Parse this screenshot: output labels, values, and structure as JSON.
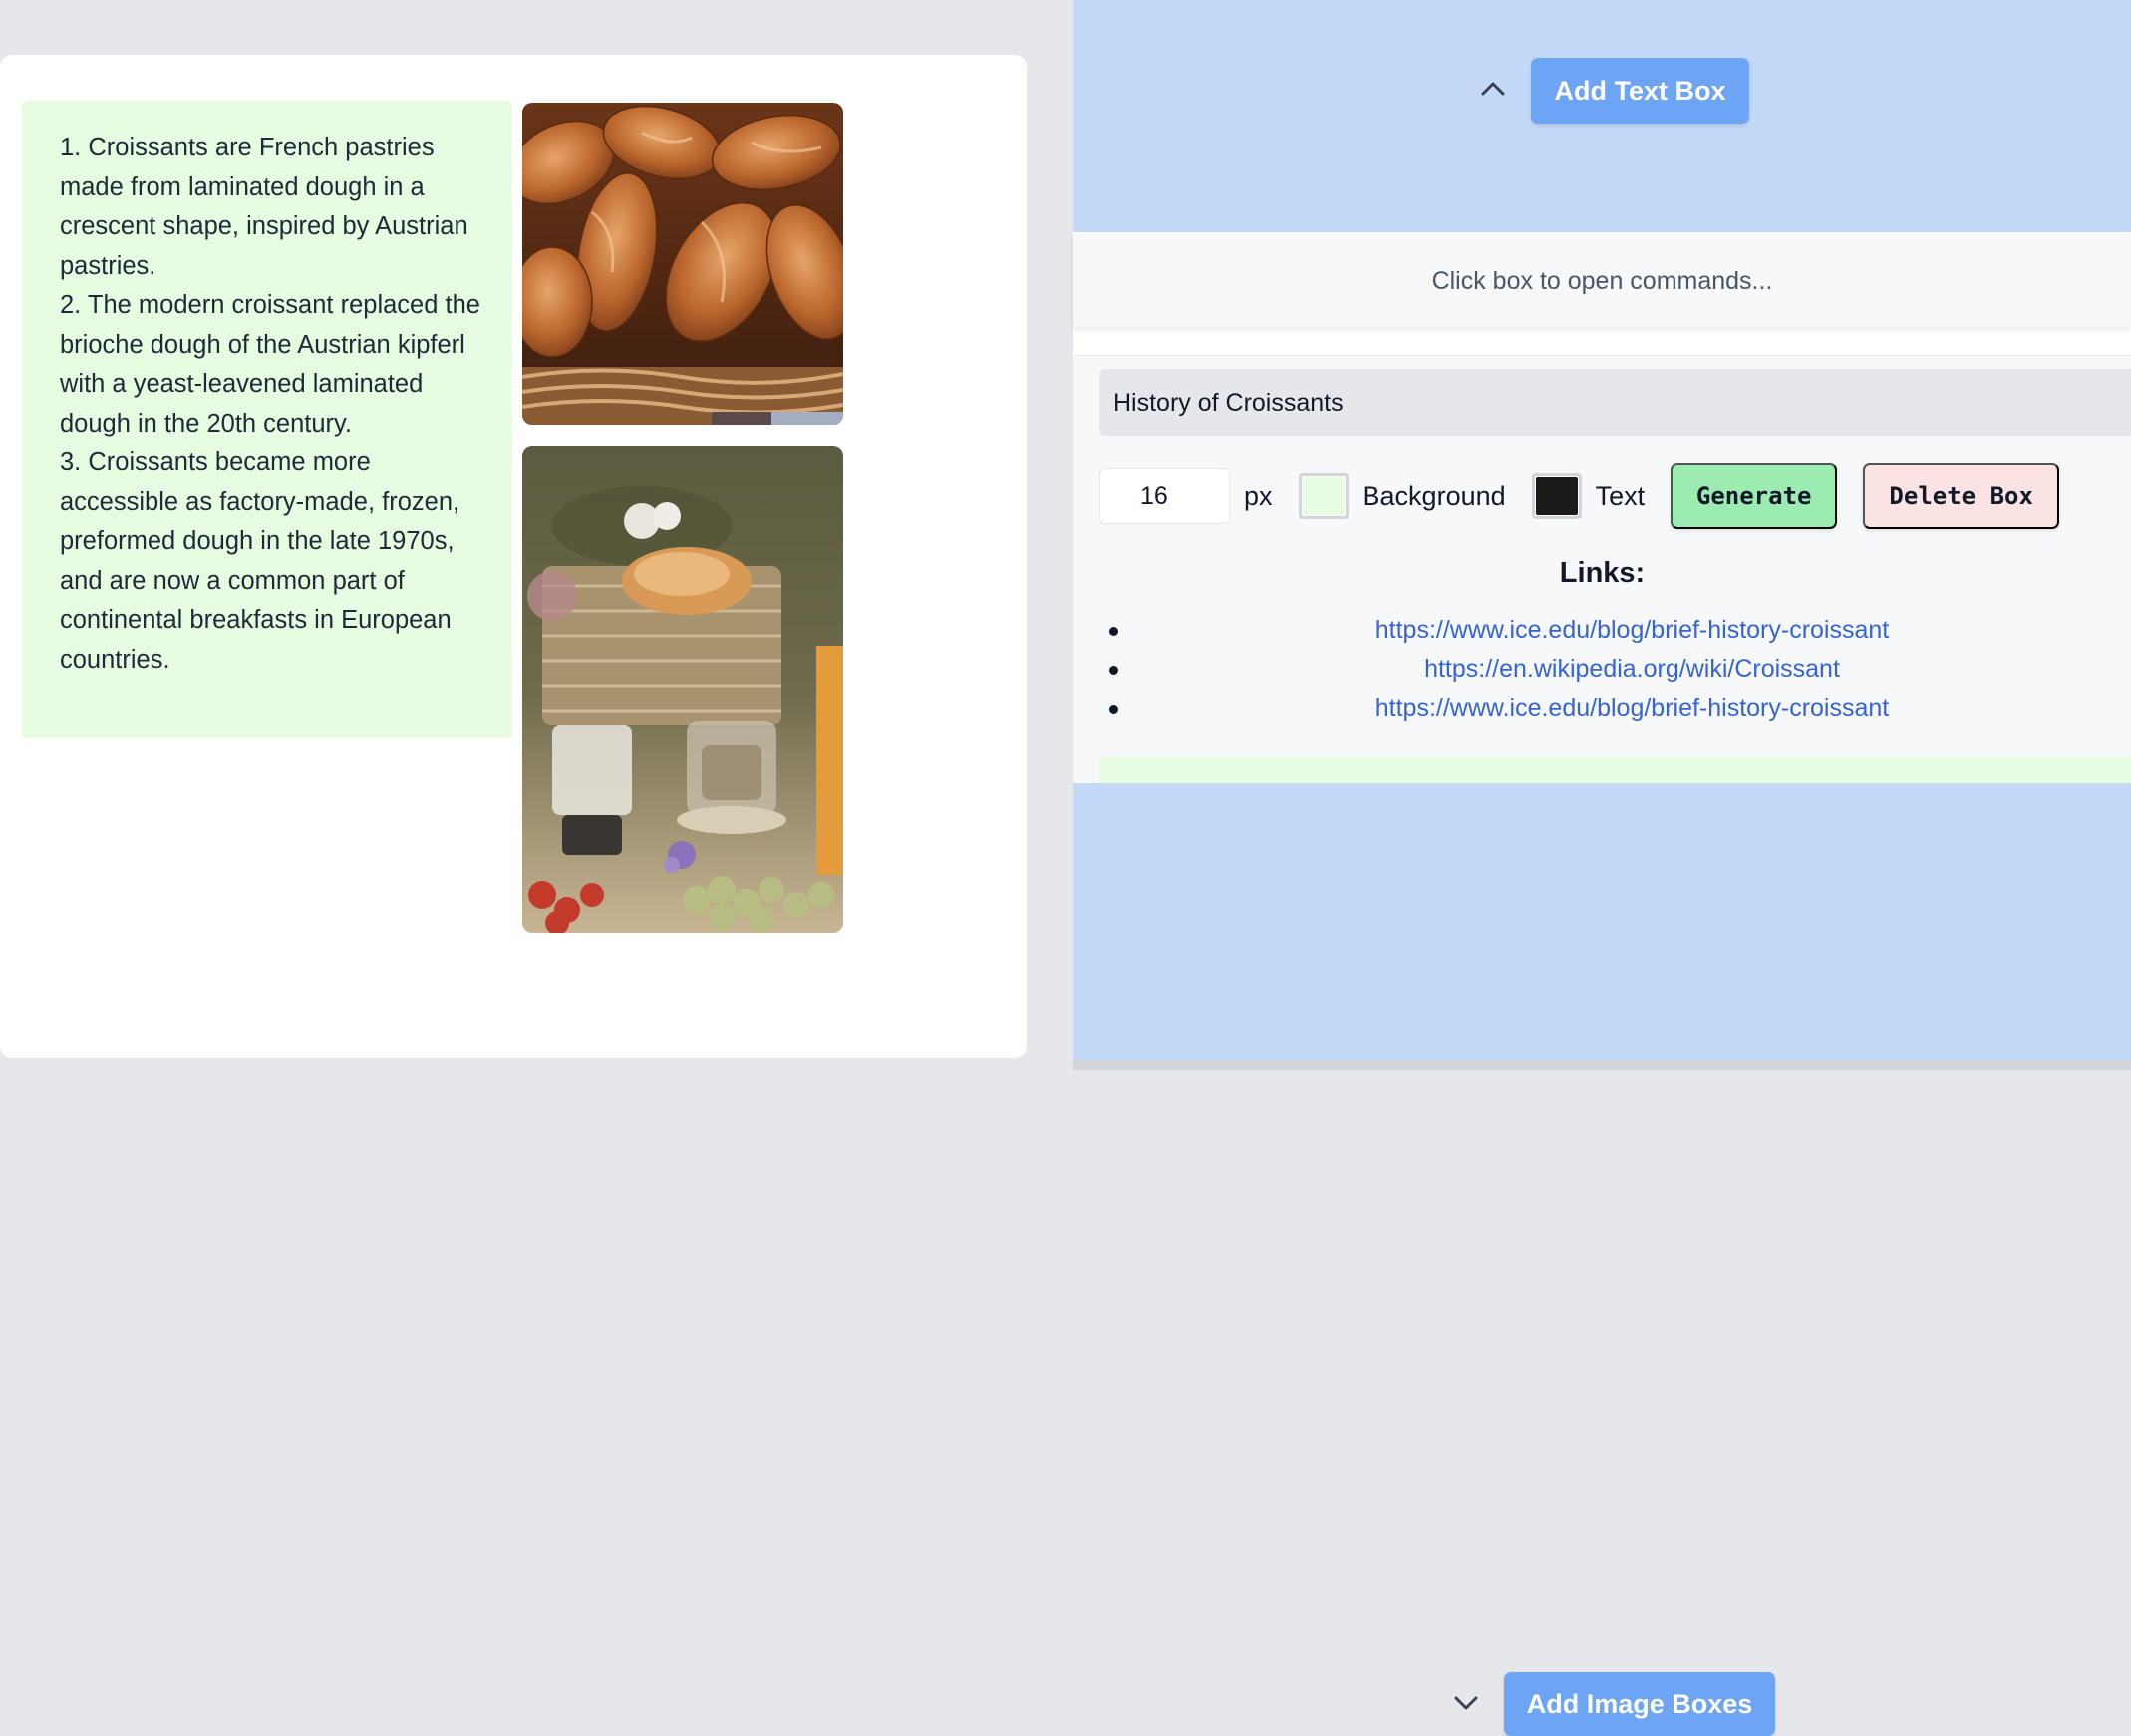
{
  "canvas": {
    "text_box": {
      "paragraphs": [
        "1. Croissants are French pastries made from laminated dough in a crescent shape, inspired by Austrian pastries.",
        "2. The modern croissant replaced the brioche dough of the Austrian kipferl with a yeast-leavened laminated dough in the 20th century.",
        "3. Croissants became more accessible as factory-made, frozen, preformed dough in the late 1970s, and are now a common part of continental breakfasts in European countries."
      ],
      "background_color": "#e7fbe1"
    },
    "images": [
      {
        "subject": "basket of croissants"
      },
      {
        "subject": "picnic basket with croissants, drinks and fruit"
      }
    ]
  },
  "panel": {
    "add_text_button": "Add Text Box",
    "add_image_button": "Add Image Boxes",
    "commands_hint": "Click box to open commands...",
    "editor": {
      "title_value": "History of Croissants",
      "font_size_value": "16",
      "font_size_unit": "px",
      "background_label": "Background",
      "background_color": "#e7fbe1",
      "text_label": "Text",
      "text_color": "#1a1a1a",
      "generate_button": "Generate",
      "delete_button": "Delete Box",
      "links_heading": "Links:",
      "links": [
        "https://www.ice.edu/blog/brief-history-croissant",
        "https://en.wikipedia.org/wiki/Croissant",
        "https://www.ice.edu/blog/brief-history-croissant"
      ]
    }
  },
  "icons": {
    "collapse": "chevron-up-icon",
    "expand": "chevron-down-icon"
  },
  "colors": {
    "accent_blue": "#6ea4f4",
    "drop_zone": "#c4d9f8",
    "generate": "#9cebb3",
    "delete": "#fbe3e3",
    "link": "#3563d6"
  }
}
